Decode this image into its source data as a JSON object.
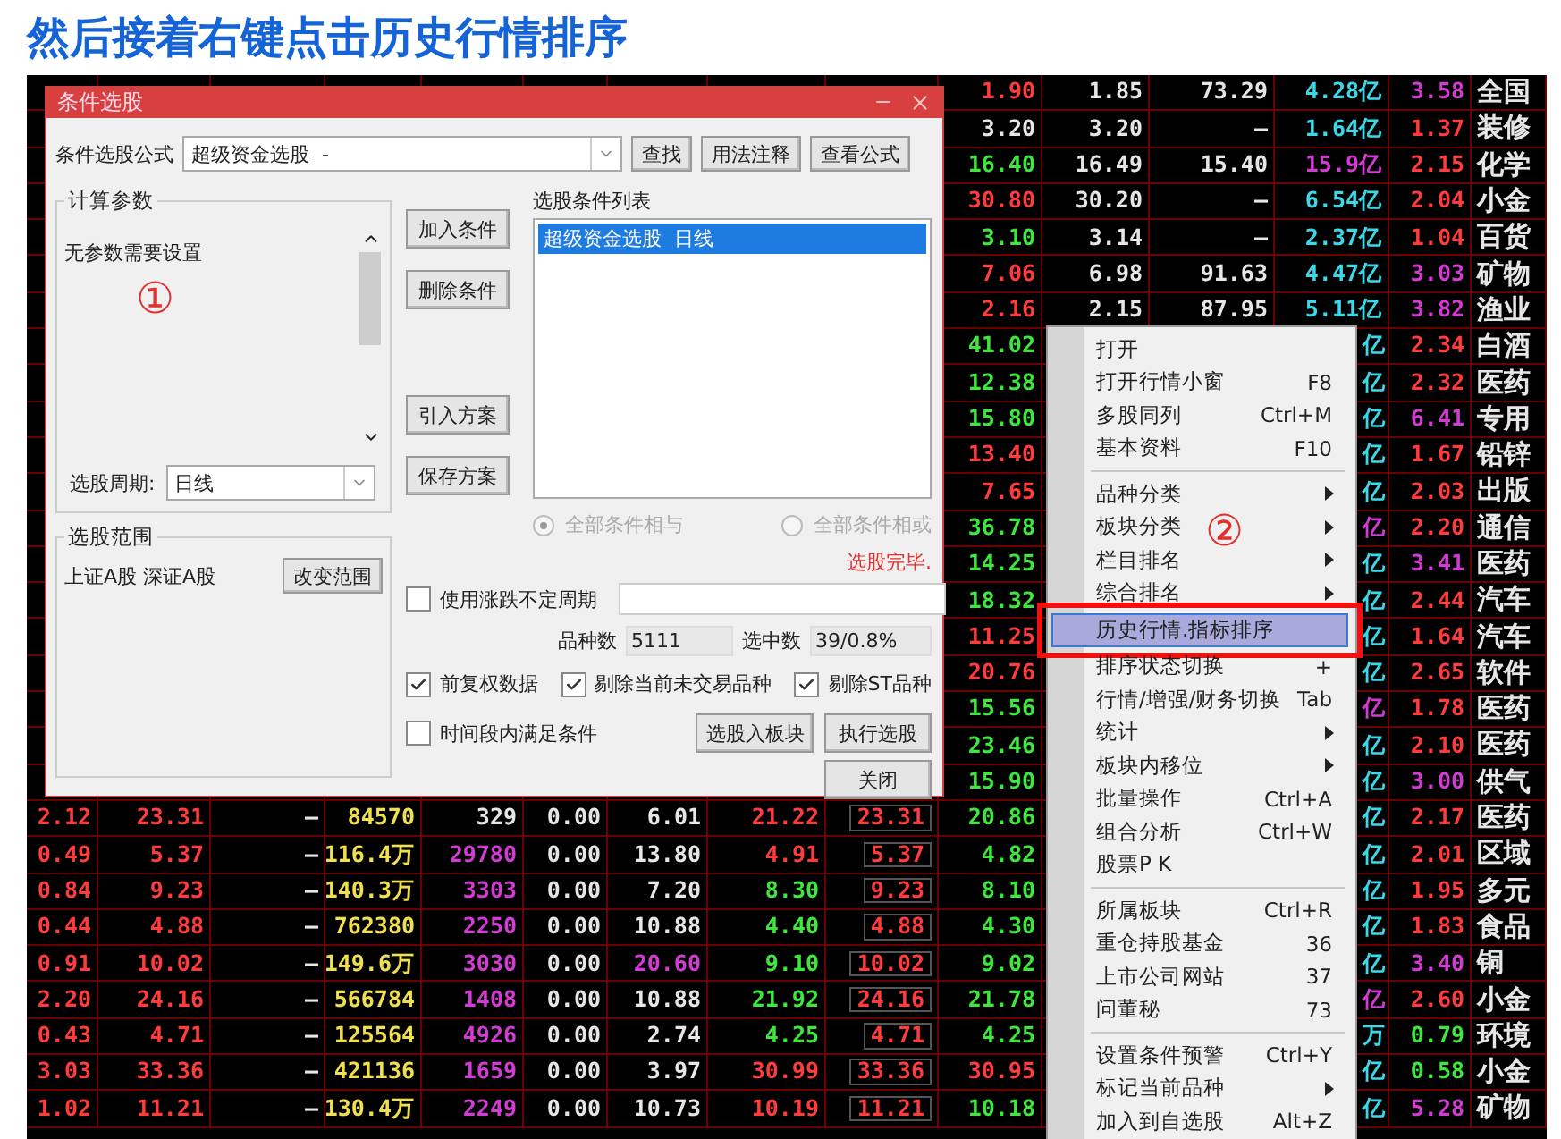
{
  "heading": "然后接着右键点击历史行情排序",
  "table": {
    "rows": [
      {
        "right": [
          {
            "text": "1.90",
            "color": "#ff3c3c"
          },
          {
            "text": "1.85",
            "color": "#e6e6e6"
          },
          {
            "text": "73.29",
            "color": "#e6e6e6"
          },
          {
            "text": "4.28亿",
            "color": "#3cd8e8"
          },
          {
            "text": "3.58",
            "color": "#d23cd2"
          },
          {
            "text": "全国"
          }
        ]
      },
      {
        "right": [
          {
            "text": "3.20",
            "color": "#e6e6e6"
          },
          {
            "text": "3.20",
            "color": "#e6e6e6"
          },
          {
            "text": "—",
            "color": "#e6e6e6"
          },
          {
            "text": "1.64亿",
            "color": "#3cd8e8"
          },
          {
            "text": "1.37",
            "color": "#ff3c3c"
          },
          {
            "text": "装修"
          }
        ]
      },
      {
        "right": [
          {
            "text": "16.40",
            "color": "#3ee63e"
          },
          {
            "text": "16.49",
            "color": "#e6e6e6"
          },
          {
            "text": "15.40",
            "color": "#e6e6e6"
          },
          {
            "text": "15.9亿",
            "color": "#d23cd2"
          },
          {
            "text": "2.15",
            "color": "#ff3c3c"
          },
          {
            "text": "化学"
          }
        ]
      },
      {
        "right": [
          {
            "text": "30.80",
            "color": "#ff3c3c"
          },
          {
            "text": "30.20",
            "color": "#e6e6e6"
          },
          {
            "text": "—",
            "color": "#e6e6e6"
          },
          {
            "text": "6.54亿",
            "color": "#3cd8e8"
          },
          {
            "text": "2.04",
            "color": "#ff3c3c"
          },
          {
            "text": "小金"
          }
        ]
      },
      {
        "right": [
          {
            "text": "3.10",
            "color": "#3ee63e"
          },
          {
            "text": "3.14",
            "color": "#e6e6e6"
          },
          {
            "text": "—",
            "color": "#e6e6e6"
          },
          {
            "text": "2.37亿",
            "color": "#3cd8e8"
          },
          {
            "text": "1.04",
            "color": "#ff3c3c"
          },
          {
            "text": "百货"
          }
        ]
      },
      {
        "right": [
          {
            "text": "7.06",
            "color": "#ff3c3c"
          },
          {
            "text": "6.98",
            "color": "#e6e6e6"
          },
          {
            "text": "91.63",
            "color": "#e6e6e6"
          },
          {
            "text": "4.47亿",
            "color": "#3cd8e8"
          },
          {
            "text": "3.03",
            "color": "#d23cd2"
          },
          {
            "text": "矿物"
          }
        ]
      },
      {
        "right": [
          {
            "text": "2.16",
            "color": "#ff3c3c"
          },
          {
            "text": "2.15",
            "color": "#e6e6e6"
          },
          {
            "text": "87.95",
            "color": "#e6e6e6"
          },
          {
            "text": "5.11亿",
            "color": "#3cd8e8"
          },
          {
            "text": "3.82",
            "color": "#d23cd2"
          },
          {
            "text": "渔业"
          }
        ]
      },
      {
        "right": [
          {
            "text": "41.02",
            "color": "#3ee63e"
          },
          {
            "text": "亿",
            "color": "#3cd8e8"
          },
          {
            "text": "2.34",
            "color": "#ff3c3c"
          },
          {
            "text": "白酒"
          }
        ]
      },
      {
        "right": [
          {
            "text": "12.38",
            "color": "#3ee63e"
          },
          {
            "text": "亿",
            "color": "#3cd8e8"
          },
          {
            "text": "2.32",
            "color": "#ff3c3c"
          },
          {
            "text": "医药"
          }
        ]
      },
      {
        "right": [
          {
            "text": "15.80",
            "color": "#3ee63e"
          },
          {
            "text": "亿",
            "color": "#3cd8e8"
          },
          {
            "text": "6.41",
            "color": "#d23cd2"
          },
          {
            "text": "专用"
          }
        ]
      },
      {
        "right": [
          {
            "text": "13.40",
            "color": "#ff3c3c"
          },
          {
            "text": "亿",
            "color": "#3cd8e8"
          },
          {
            "text": "1.67",
            "color": "#ff3c3c"
          },
          {
            "text": "铅锌"
          }
        ]
      },
      {
        "right": [
          {
            "text": "7.65",
            "color": "#ff3c3c"
          },
          {
            "text": "亿",
            "color": "#3cd8e8"
          },
          {
            "text": "2.03",
            "color": "#ff3c3c"
          },
          {
            "text": "出版"
          }
        ]
      },
      {
        "right": [
          {
            "text": "36.78",
            "color": "#3ee63e"
          },
          {
            "text": "亿",
            "color": "#d23cd2"
          },
          {
            "text": "2.20",
            "color": "#ff3c3c"
          },
          {
            "text": "通信"
          }
        ]
      },
      {
        "right": [
          {
            "text": "14.25",
            "color": "#3ee63e"
          },
          {
            "text": "亿",
            "color": "#3cd8e8"
          },
          {
            "text": "3.41",
            "color": "#d23cd2"
          },
          {
            "text": "医药"
          }
        ]
      },
      {
        "right": [
          {
            "text": "18.32",
            "color": "#3ee63e"
          },
          {
            "text": "亿",
            "color": "#3cd8e8"
          },
          {
            "text": "2.44",
            "color": "#ff3c3c"
          },
          {
            "text": "汽车"
          }
        ]
      },
      {
        "right": [
          {
            "text": "11.25",
            "color": "#ff3c3c"
          },
          {
            "text": "亿",
            "color": "#3cd8e8"
          },
          {
            "text": "1.64",
            "color": "#ff3c3c"
          },
          {
            "text": "汽车"
          }
        ]
      },
      {
        "right": [
          {
            "text": "20.76",
            "color": "#ff3c3c"
          },
          {
            "text": "亿",
            "color": "#3cd8e8"
          },
          {
            "text": "2.65",
            "color": "#ff3c3c"
          },
          {
            "text": "软件"
          }
        ]
      },
      {
        "right": [
          {
            "text": "15.56",
            "color": "#3ee63e"
          },
          {
            "text": "亿",
            "color": "#d23cd2"
          },
          {
            "text": "1.78",
            "color": "#ff3c3c"
          },
          {
            "text": "医药"
          }
        ]
      },
      {
        "right": [
          {
            "text": "23.46",
            "color": "#3ee63e"
          },
          {
            "text": "亿",
            "color": "#3cd8e8"
          },
          {
            "text": "2.10",
            "color": "#ff3c3c"
          },
          {
            "text": "医药"
          }
        ]
      },
      {
        "right": [
          {
            "text": "15.90",
            "color": "#3ee63e"
          },
          {
            "text": "亿",
            "color": "#3cd8e8"
          },
          {
            "text": "3.00",
            "color": "#d23cd2"
          },
          {
            "text": "供气"
          }
        ]
      },
      {
        "left": [
          {
            "text": "2.12",
            "color": "#ff3c3c"
          },
          {
            "text": "23.31",
            "color": "#ff3c3c"
          },
          {
            "text": "—",
            "color": "#e6e6e6"
          },
          {
            "text": "84570",
            "color": "#f0e050"
          },
          {
            "text": "329",
            "color": "#e6e6e6"
          },
          {
            "text": "0.00",
            "color": "#e6e6e6"
          },
          {
            "text": "6.01",
            "color": "#e6e6e6"
          },
          {
            "text": "21.22",
            "color": "#ff3c3c"
          },
          {
            "text": "23.31",
            "color": "#ff3c3c"
          }
        ],
        "right": [
          {
            "text": "20.86",
            "color": "#3ee63e"
          },
          {
            "text": "亿",
            "color": "#3cd8e8"
          },
          {
            "text": "2.17",
            "color": "#ff3c3c"
          },
          {
            "text": "医药"
          }
        ]
      },
      {
        "left": [
          {
            "text": "0.49",
            "color": "#ff3c3c"
          },
          {
            "text": "5.37",
            "color": "#ff3c3c"
          },
          {
            "text": "—",
            "color": "#e6e6e6"
          },
          {
            "text": "116.4万",
            "color": "#f0e050"
          },
          {
            "text": "29780",
            "color": "#d23cd2"
          },
          {
            "text": "0.00",
            "color": "#e6e6e6"
          },
          {
            "text": "13.80",
            "color": "#e6e6e6"
          },
          {
            "text": "4.91",
            "color": "#ff3c3c"
          },
          {
            "text": "5.37",
            "color": "#ff3c3c"
          }
        ],
        "right": [
          {
            "text": "4.82",
            "color": "#3ee63e"
          },
          {
            "text": "亿",
            "color": "#3cd8e8"
          },
          {
            "text": "2.01",
            "color": "#ff3c3c"
          },
          {
            "text": "区域"
          }
        ]
      },
      {
        "left": [
          {
            "text": "0.84",
            "color": "#ff3c3c"
          },
          {
            "text": "9.23",
            "color": "#ff3c3c"
          },
          {
            "text": "—",
            "color": "#e6e6e6"
          },
          {
            "text": "140.3万",
            "color": "#f0e050"
          },
          {
            "text": "3303",
            "color": "#d23cd2"
          },
          {
            "text": "0.00",
            "color": "#e6e6e6"
          },
          {
            "text": "7.20",
            "color": "#e6e6e6"
          },
          {
            "text": "8.30",
            "color": "#3ee63e"
          },
          {
            "text": "9.23",
            "color": "#ff3c3c"
          }
        ],
        "right": [
          {
            "text": "8.10",
            "color": "#3ee63e"
          },
          {
            "text": "亿",
            "color": "#3cd8e8"
          },
          {
            "text": "1.95",
            "color": "#ff3c3c"
          },
          {
            "text": "多元"
          }
        ]
      },
      {
        "left": [
          {
            "text": "0.44",
            "color": "#ff3c3c"
          },
          {
            "text": "4.88",
            "color": "#ff3c3c"
          },
          {
            "text": "—",
            "color": "#e6e6e6"
          },
          {
            "text": "762380",
            "color": "#f0e050"
          },
          {
            "text": "2250",
            "color": "#d23cd2"
          },
          {
            "text": "0.00",
            "color": "#e6e6e6"
          },
          {
            "text": "10.88",
            "color": "#e6e6e6"
          },
          {
            "text": "4.40",
            "color": "#3ee63e"
          },
          {
            "text": "4.88",
            "color": "#ff3c3c"
          }
        ],
        "right": [
          {
            "text": "4.30",
            "color": "#3ee63e"
          },
          {
            "text": "亿",
            "color": "#3cd8e8"
          },
          {
            "text": "1.83",
            "color": "#ff3c3c"
          },
          {
            "text": "食品"
          }
        ]
      },
      {
        "left": [
          {
            "text": "0.91",
            "color": "#ff3c3c"
          },
          {
            "text": "10.02",
            "color": "#ff3c3c"
          },
          {
            "text": "—",
            "color": "#e6e6e6"
          },
          {
            "text": "149.6万",
            "color": "#f0e050"
          },
          {
            "text": "3030",
            "color": "#d23cd2"
          },
          {
            "text": "0.00",
            "color": "#e6e6e6"
          },
          {
            "text": "20.60",
            "color": "#d23cd2"
          },
          {
            "text": "9.10",
            "color": "#3ee63e"
          },
          {
            "text": "10.02",
            "color": "#ff3c3c"
          }
        ],
        "right": [
          {
            "text": "9.02",
            "color": "#3ee63e"
          },
          {
            "text": "亿",
            "color": "#3cd8e8"
          },
          {
            "text": "3.40",
            "color": "#d23cd2"
          },
          {
            "text": "铜"
          }
        ]
      },
      {
        "left": [
          {
            "text": "2.20",
            "color": "#ff3c3c"
          },
          {
            "text": "24.16",
            "color": "#ff3c3c"
          },
          {
            "text": "—",
            "color": "#e6e6e6"
          },
          {
            "text": "566784",
            "color": "#f0e050"
          },
          {
            "text": "1408",
            "color": "#d23cd2"
          },
          {
            "text": "0.00",
            "color": "#e6e6e6"
          },
          {
            "text": "10.88",
            "color": "#e6e6e6"
          },
          {
            "text": "21.92",
            "color": "#3ee63e"
          },
          {
            "text": "24.16",
            "color": "#ff3c3c"
          }
        ],
        "right": [
          {
            "text": "21.78",
            "color": "#3ee63e"
          },
          {
            "text": "亿",
            "color": "#d23cd2"
          },
          {
            "text": "2.60",
            "color": "#ff3c3c"
          },
          {
            "text": "小金"
          }
        ]
      },
      {
        "left": [
          {
            "text": "0.43",
            "color": "#ff3c3c"
          },
          {
            "text": "4.71",
            "color": "#ff3c3c"
          },
          {
            "text": "—",
            "color": "#e6e6e6"
          },
          {
            "text": "125564",
            "color": "#f0e050"
          },
          {
            "text": "4926",
            "color": "#d23cd2"
          },
          {
            "text": "0.00",
            "color": "#e6e6e6"
          },
          {
            "text": "2.74",
            "color": "#e6e6e6"
          },
          {
            "text": "4.25",
            "color": "#3ee63e"
          },
          {
            "text": "4.71",
            "color": "#ff3c3c"
          }
        ],
        "right": [
          {
            "text": "4.25",
            "color": "#3ee63e"
          },
          {
            "text": "万",
            "color": "#3cd8e8"
          },
          {
            "text": "0.79",
            "color": "#3ee63e"
          },
          {
            "text": "环境"
          }
        ]
      },
      {
        "left": [
          {
            "text": "3.03",
            "color": "#ff3c3c"
          },
          {
            "text": "33.36",
            "color": "#ff3c3c"
          },
          {
            "text": "—",
            "color": "#e6e6e6"
          },
          {
            "text": "421136",
            "color": "#f0e050"
          },
          {
            "text": "1659",
            "color": "#d23cd2"
          },
          {
            "text": "0.00",
            "color": "#e6e6e6"
          },
          {
            "text": "3.97",
            "color": "#e6e6e6"
          },
          {
            "text": "30.99",
            "color": "#ff3c3c"
          },
          {
            "text": "33.36",
            "color": "#ff3c3c"
          }
        ],
        "right": [
          {
            "text": "30.95",
            "color": "#ff3c3c"
          },
          {
            "text": "亿",
            "color": "#3cd8e8"
          },
          {
            "text": "0.58",
            "color": "#3ee63e"
          },
          {
            "text": "小金"
          }
        ]
      },
      {
        "left": [
          {
            "text": "1.02",
            "color": "#ff3c3c"
          },
          {
            "text": "11.21",
            "color": "#ff3c3c"
          },
          {
            "text": "—",
            "color": "#e6e6e6"
          },
          {
            "text": "130.4万",
            "color": "#f0e050"
          },
          {
            "text": "2249",
            "color": "#d23cd2"
          },
          {
            "text": "0.00",
            "color": "#e6e6e6"
          },
          {
            "text": "10.73",
            "color": "#e6e6e6"
          },
          {
            "text": "10.19",
            "color": "#ff3c3c"
          },
          {
            "text": "11.21",
            "color": "#ff3c3c"
          }
        ],
        "right": [
          {
            "text": "10.18",
            "color": "#3ee63e"
          },
          {
            "text": "亿",
            "color": "#3cd8e8"
          },
          {
            "text": "5.28",
            "color": "#d23cd2"
          },
          {
            "text": "矿物"
          }
        ]
      }
    ]
  },
  "dialog": {
    "title": "条件选股",
    "formula": {
      "label": "条件选股公式",
      "value": "超级资金选股  -"
    },
    "top_buttons": [
      "查找",
      "用法注释",
      "查看公式"
    ],
    "params": {
      "title": "计算参数",
      "message": "无参数需要设置",
      "marker": "①",
      "period_label": "选股周期:",
      "period_value": "日线"
    },
    "scope": {
      "title": "选股范围",
      "value": "上证A股 深证A股",
      "button": "改变范围"
    },
    "side_buttons": [
      [
        "加入条件",
        "删除条件"
      ],
      [
        "引入方案",
        "保存方案"
      ]
    ],
    "condition_list": {
      "label": "选股条件列表",
      "items": [
        {
          "text": "超级资金选股  日线",
          "selected": true
        }
      ]
    },
    "radios": [
      {
        "label": "全部条件相与",
        "selected": true,
        "disabled": true
      },
      {
        "label": "全部条件相或",
        "selected": false,
        "disabled": true
      }
    ],
    "status": "选股完毕.",
    "variable_period": {
      "label": "使用涨跌不定周期",
      "checked": false
    },
    "stock_count": {
      "label": "品种数",
      "value": "5111"
    },
    "selected_count": {
      "label": "选中数",
      "value": "39/0.8%"
    },
    "options": [
      {
        "label": "前复权数据",
        "checked": true
      },
      {
        "label": "剔除当前未交易品种",
        "checked": true
      },
      {
        "label": "剔除ST品种",
        "checked": true
      }
    ],
    "time_window": {
      "label": "时间段内满足条件",
      "checked": false
    },
    "action_buttons": [
      "选股入板块",
      "执行选股"
    ],
    "close_button": "关闭"
  },
  "context_menu": {
    "marker": "②",
    "groups": [
      [
        {
          "label": "打开",
          "selected": false,
          "submenu": false
        },
        {
          "label": "打开行情小窗",
          "shortcut": "F8",
          "selected": false,
          "submenu": false
        },
        {
          "label": "多股同列",
          "shortcut": "Ctrl+M",
          "selected": false,
          "submenu": false
        },
        {
          "label": "基本资料",
          "shortcut": "F10",
          "selected": false,
          "submenu": false
        }
      ],
      [
        {
          "label": "品种分类",
          "selected": false,
          "submenu": true
        },
        {
          "label": "板块分类",
          "selected": false,
          "submenu": true
        },
        {
          "label": "栏目排名",
          "selected": false,
          "submenu": true
        },
        {
          "label": "综合排名",
          "selected": false,
          "submenu": true
        },
        {
          "label": "历史行情.指标排序",
          "selected": true,
          "submenu": false
        },
        {
          "label": "排序状态切换",
          "shortcut": "+",
          "selected": false,
          "submenu": false
        },
        {
          "label": "行情/增强/财务切换",
          "shortcut": "Tab",
          "selected": false,
          "submenu": false
        },
        {
          "label": "统计",
          "selected": false,
          "submenu": true
        },
        {
          "label": "板块内移位",
          "selected": false,
          "submenu": true
        },
        {
          "label": "批量操作",
          "shortcut": "Ctrl+A",
          "selected": false,
          "submenu": false
        },
        {
          "label": "组合分析",
          "shortcut": "Ctrl+W",
          "selected": false,
          "submenu": false
        },
        {
          "label": "股票P K",
          "selected": false,
          "submenu": false
        }
      ],
      [
        {
          "label": "所属板块",
          "shortcut": "Ctrl+R",
          "selected": false,
          "submenu": false
        },
        {
          "label": "重仓持股基金",
          "shortcut": "36",
          "selected": false,
          "submenu": false
        },
        {
          "label": "上市公司网站",
          "shortcut": "37",
          "selected": false,
          "submenu": false
        },
        {
          "label": "问董秘",
          "shortcut": "73",
          "selected": false,
          "submenu": false
        }
      ],
      [
        {
          "label": "设置条件预警",
          "shortcut": "Ctrl+Y",
          "selected": false,
          "submenu": false
        },
        {
          "label": "标记当前品种",
          "selected": false,
          "submenu": true
        },
        {
          "label": "加入到自选股",
          "shortcut": "Alt+Z",
          "selected": false,
          "submenu": false
        }
      ]
    ]
  }
}
